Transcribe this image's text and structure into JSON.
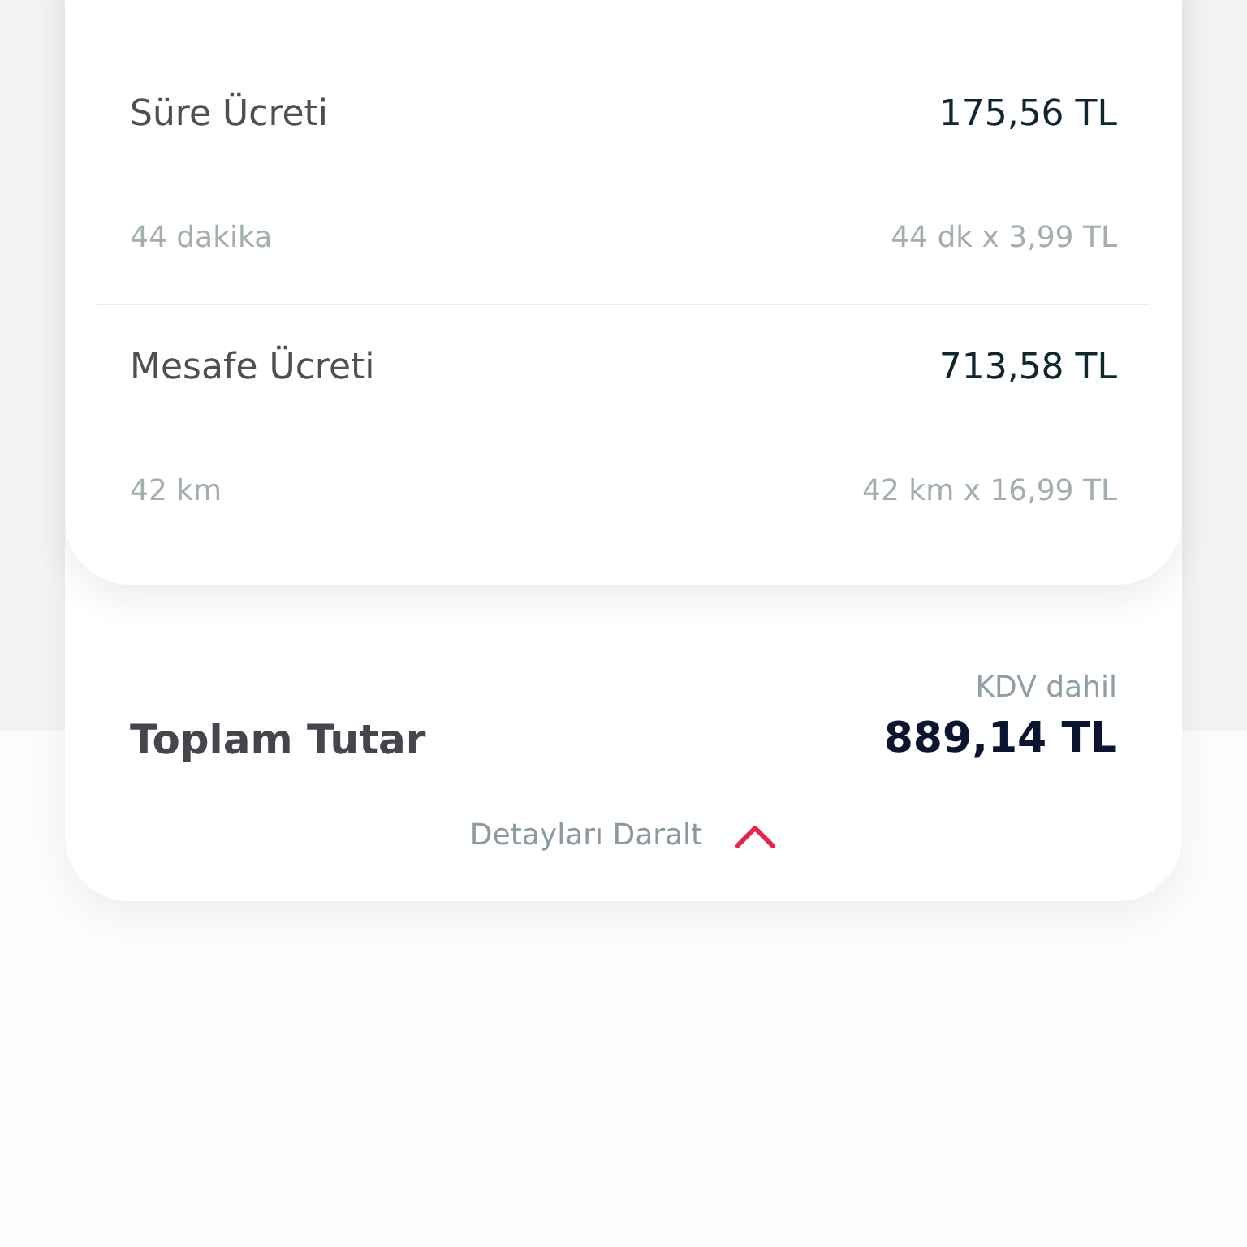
{
  "fee_items": [
    {
      "label": "Süre Ücreti",
      "amount": "175,56 TL",
      "detail": "44 dakika",
      "calculation": "44 dk x 3,99 TL"
    },
    {
      "label": "Mesafe Ücreti",
      "amount": "713,58 TL",
      "detail": "42 km",
      "calculation": "42 km x 16,99 TL"
    }
  ],
  "total": {
    "label": "Toplam Tutar",
    "tax_note": "KDV dahil",
    "amount": "889,14 TL"
  },
  "details_toggle": {
    "label": "Detayları Daralt",
    "expanded": true
  }
}
